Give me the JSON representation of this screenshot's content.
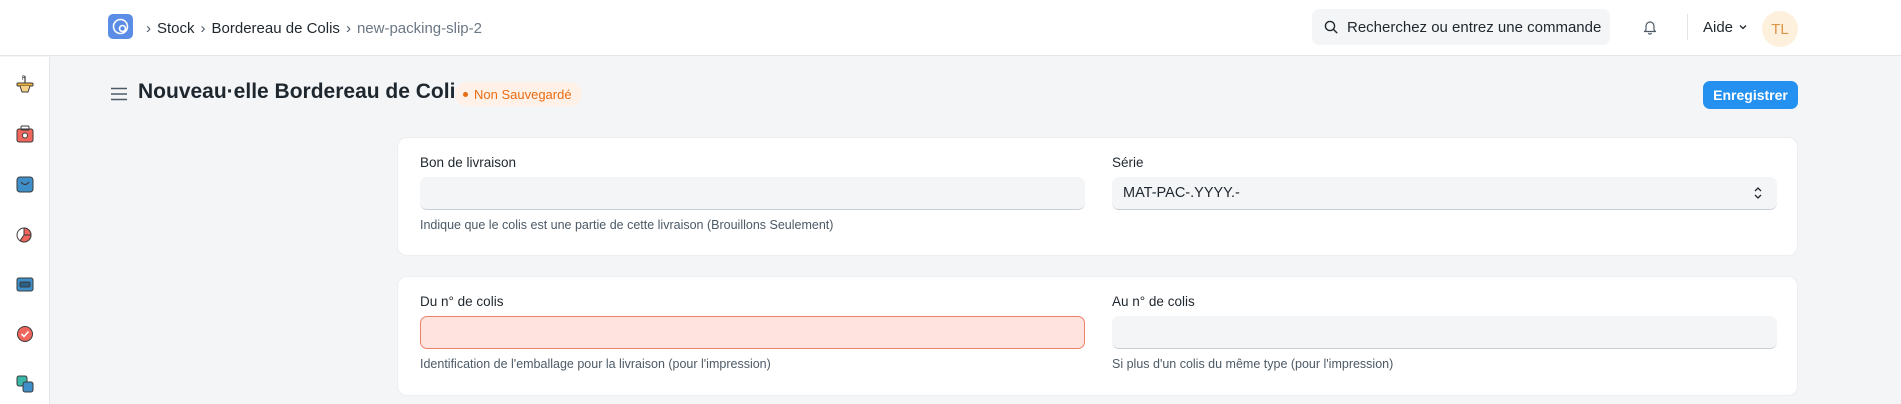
{
  "navbar": {
    "breadcrumbs": [
      "Stock",
      "Bordereau de Colis",
      "new-packing-slip-2"
    ],
    "search_placeholder": "Recherchez ou entrez une commande",
    "help_label": "Aide",
    "avatar_initials": "TL"
  },
  "sidebar": {
    "icons": [
      "stock-desk-icon",
      "accounting-icon",
      "buying-icon",
      "selling-icon",
      "assets-icon",
      "quality-icon",
      "projects-icon"
    ]
  },
  "page": {
    "title": "Nouveau·elle Bordereau de Colis",
    "status": "Non Sauvegardé",
    "save_label": "Enregistrer"
  },
  "form": {
    "delivery_note": {
      "label": "Bon de livraison",
      "value": "",
      "help": "Indique que le colis est une partie de cette livraison (Brouillons Seulement)"
    },
    "series": {
      "label": "Série",
      "value": "MAT-PAC-.YYYY.-"
    },
    "from_case_no": {
      "label": "Du n° de colis",
      "value": "",
      "help": "Identification de l'emballage pour la livraison (pour l'impression)"
    },
    "to_case_no": {
      "label": "Au n° de colis",
      "value": "",
      "help": "Si plus d'un colis du même type (pour l'impression)"
    }
  },
  "colors": {
    "primary": "#2490ef",
    "status_orange": "#e86c13",
    "error_bg": "#ffe3df",
    "error_border": "#f0806c"
  }
}
